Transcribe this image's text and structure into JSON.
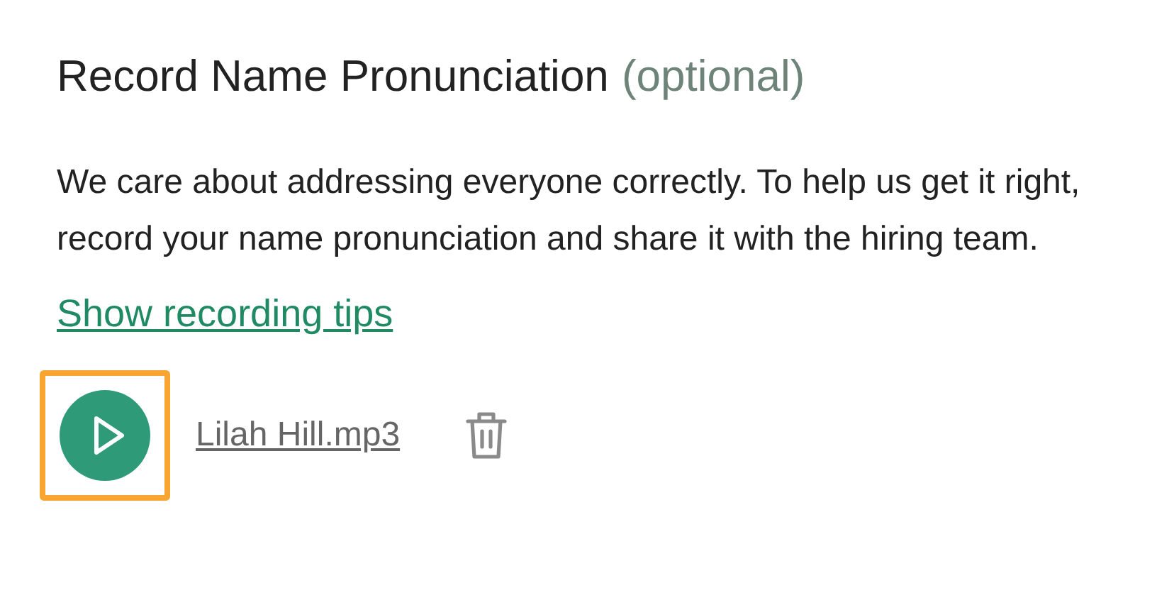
{
  "heading": {
    "title": "Record Name Pronunciation",
    "note": "(optional)"
  },
  "description": "We care about addressing everyone correctly. To help us get it right, record your name pronunciation and share it with the hiring team.",
  "tips_link": "Show recording tips",
  "recording": {
    "play_button": {
      "focused": true
    },
    "file_name": "Lilah Hill.mp3"
  }
}
